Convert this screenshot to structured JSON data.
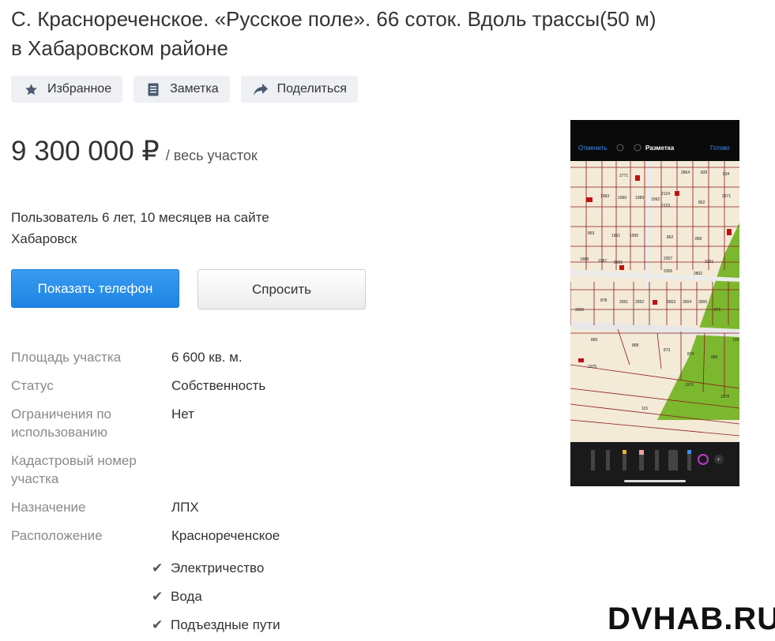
{
  "listing": {
    "title": "С. Краснореченское. «Русское поле». 66 соток. Вдоль трассы(50 м) в Хабаровском районе"
  },
  "actions": [
    {
      "label": "Избранное",
      "icon": "star-icon"
    },
    {
      "label": "Заметка",
      "icon": "note-icon"
    },
    {
      "label": "Поделиться",
      "icon": "share-icon"
    }
  ],
  "price": {
    "amount": "9 300 000 ₽",
    "unit": "/ весь участок"
  },
  "seller": {
    "since": "Пользователь 6 лет, 10 месяцев на сайте",
    "city": "Хабаровск"
  },
  "buttons": {
    "phone": "Показать телефон",
    "ask": "Спросить"
  },
  "colors": {
    "primary": "#1d84e3",
    "plot_green": "#7cb82f",
    "plot_lines": "#8b1a1a"
  },
  "params": [
    {
      "label": "Площадь участка",
      "value": "6 600 кв. м."
    },
    {
      "label": "Статус",
      "value": "Собственность"
    },
    {
      "label": "Ограничения по использованию",
      "value": "Нет"
    },
    {
      "label": "Кадастровый номер участка",
      "value": ""
    },
    {
      "label": "Назначение",
      "value": "ЛПХ"
    },
    {
      "label": "Расположение",
      "value": "Краснореченское"
    }
  ],
  "features": [
    "Электричество",
    "Вода",
    "Подъездные пути"
  ],
  "photo": {
    "toolbar": {
      "cancel": "Отменить",
      "title": "Разметка",
      "done": "Готово"
    },
    "plot_numbers": [
      "2771",
      "2864",
      "839",
      "834",
      "2124",
      "2123",
      "1989",
      "1983",
      "1990",
      "1992",
      "852",
      "2571",
      "853",
      "1991",
      "1995",
      "862",
      "866",
      "2357",
      "2131",
      "2356",
      "2802",
      "2965",
      "1987",
      "1988",
      "878",
      "2951",
      "2952",
      "3003",
      "3004",
      "3006",
      "871",
      "3000",
      "869",
      "868",
      "873",
      "874",
      "880",
      "1975",
      "1976",
      "1978",
      "115",
      "1905"
    ]
  },
  "watermark": "DVHAB.RU"
}
